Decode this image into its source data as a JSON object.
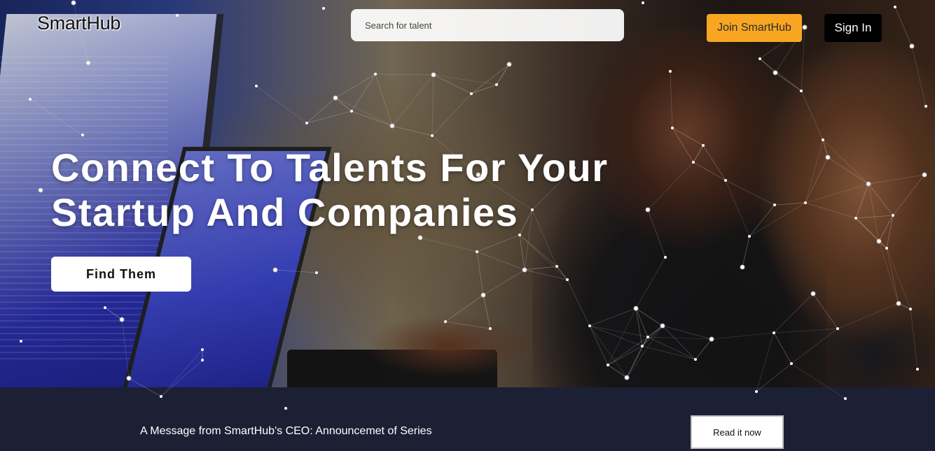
{
  "header": {
    "logo": "SmartHub",
    "search_placeholder": "Search for talent",
    "join_label": "Join SmartHub",
    "signin_label": "Sign In"
  },
  "hero": {
    "headline_line1": "Connect To Talents For Your",
    "headline_line2": "Startup And Companies",
    "cta_label": "Find Them"
  },
  "banner": {
    "message": "A Message from SmartHub's CEO: Announcemet of Series",
    "read_label": "Read it now"
  },
  "colors": {
    "accent": "#f8a622",
    "banner_bg": "#1b2035",
    "signin_bg": "#000000",
    "cta_bg": "#ffffff"
  }
}
